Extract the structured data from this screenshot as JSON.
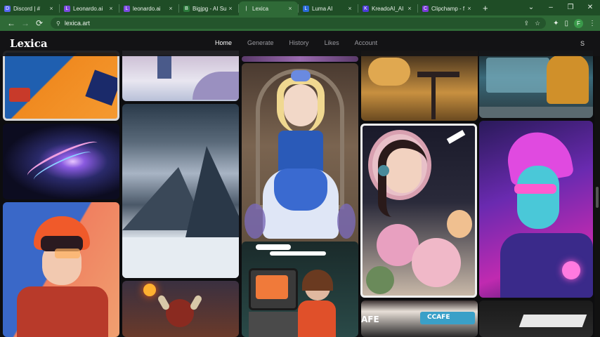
{
  "tabs": [
    {
      "title": "Discord | #",
      "fav": "D",
      "color": "#5865f2"
    },
    {
      "title": "Leonardo.ai",
      "fav": "L",
      "color": "#7a4ae0"
    },
    {
      "title": "leonardo.ai",
      "fav": "L",
      "color": "#7a4ae0"
    },
    {
      "title": "Bigjpg - AI Su",
      "fav": "B",
      "color": "#2a7a3a"
    },
    {
      "title": "Lexica",
      "fav": "|",
      "color": "#ffffff"
    },
    {
      "title": "Luma AI",
      "fav": "L",
      "color": "#2b6ad8"
    },
    {
      "title": "KreadoAI_AI",
      "fav": "K",
      "color": "#4b3ad8"
    },
    {
      "title": "Clipchamp - f",
      "fav": "C",
      "color": "#7a3ad8"
    }
  ],
  "active_tab_index": 4,
  "new_tab_label": "+",
  "window_controls": [
    "⌄",
    "–",
    "❐",
    "✕"
  ],
  "toolbar": {
    "back": "←",
    "forward": "→",
    "reload": "⟳",
    "url": "lexica.art",
    "profile_initial": "F"
  },
  "site": {
    "logo": "Lexica",
    "nav": [
      "Home",
      "Generate",
      "History",
      "Likes",
      "Account"
    ],
    "active_nav": "Home",
    "user_initial": "S"
  },
  "tiles": {
    "cafe_left": "AFE",
    "cafe_right": "CCAFE"
  }
}
